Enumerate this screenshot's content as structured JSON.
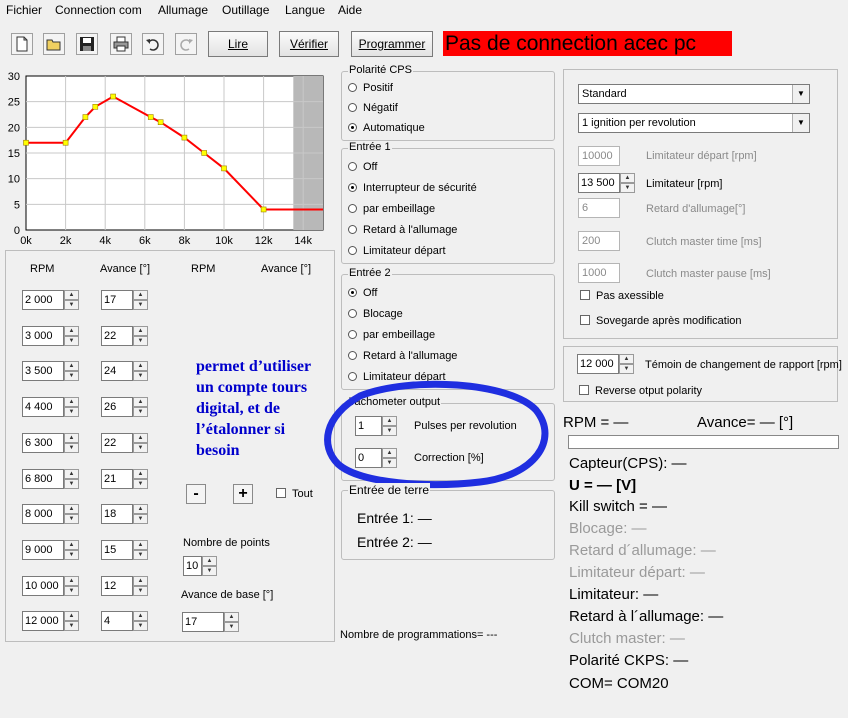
{
  "menu": [
    "Fichier",
    "Connection com",
    "Allumage",
    "Outillage",
    "Langue",
    "Aide"
  ],
  "toolbar": {
    "icons": [
      "new-file-icon",
      "open-folder-icon",
      "save-icon",
      "print-icon",
      "undo-icon",
      "redo-icon"
    ],
    "read_label": "Lire",
    "verify_label": "Vérifier",
    "program_label": "Programmer"
  },
  "status": {
    "text": "Pas de connection acec pc",
    "color": "#ff0000"
  },
  "chart_data": {
    "type": "line",
    "x": [
      0,
      2000,
      3000,
      3500,
      4400,
      6300,
      6800,
      8000,
      9000,
      10000,
      12000,
      15000
    ],
    "y": [
      17,
      17,
      22,
      24,
      26,
      22,
      21,
      18,
      15,
      12,
      4,
      4
    ],
    "markers": [
      true,
      true,
      true,
      true,
      true,
      true,
      true,
      true,
      true,
      true,
      true,
      false
    ],
    "xlim": [
      0,
      15000
    ],
    "ylim": [
      0,
      30
    ],
    "shaded_from": 13500,
    "x_tick_labels": [
      "0k",
      "2k",
      "4k",
      "6k",
      "8k",
      "10k",
      "12k",
      "14k"
    ],
    "y_tick_labels": [
      "0",
      "5",
      "10",
      "15",
      "20",
      "25",
      "30"
    ],
    "grid": true,
    "line_color": "#ff0000",
    "marker_color": "#ffff00"
  },
  "curve": {
    "header_rpm": "RPM",
    "header_advance": "Avance [°]",
    "header_rpm_2": "RPM",
    "header_advance_2": "Avance [°]",
    "rpm": [
      "2 000",
      "3 000",
      "3 500",
      "4 400",
      "6 300",
      "6 800",
      "8 000",
      "9 000",
      "10 000",
      "12 000"
    ],
    "advance": [
      "17",
      "22",
      "24",
      "26",
      "22",
      "21",
      "18",
      "15",
      "12",
      "4"
    ],
    "minus_label": "-",
    "plus_label": "+",
    "all_label": "Tout",
    "points_label": "Nombre de points",
    "points_value": "10",
    "base_advance_label": "Avance de base [°]",
    "base_advance_value": "17"
  },
  "annotation": {
    "lines": [
      "permet d’utiliser",
      "un compte tours",
      "digital, et de",
      "l’étalonner si",
      "besoin"
    ]
  },
  "polarity": {
    "title": "Polarité CPS",
    "options": [
      "Positif",
      "Négatif",
      "Automatique"
    ],
    "selected": 2
  },
  "input1": {
    "title": "Entrée 1",
    "options": [
      "Off",
      "Interrupteur de sécurité",
      "par embeillage",
      "Retard à l'allumage",
      "Limitateur départ"
    ],
    "selected": 1
  },
  "input2": {
    "title": "Entrée 2",
    "options": [
      "Off",
      "Blocage",
      "par embeillage",
      "Retard à l'allumage",
      "Limitateur départ"
    ],
    "selected": 0
  },
  "tachometer": {
    "title": "Tachometer output",
    "pulses_value": "1",
    "pulses_label": "Pulses per revolution",
    "correction_value": "0",
    "correction_label": "Correction [%]"
  },
  "ground": {
    "title": "Entrée de terre",
    "input1": "Entrée 1: —",
    "input2": "Entrée 2: —"
  },
  "programs_count": "Nombre de programmations= ---",
  "settings": {
    "mode": "Standard",
    "ignition": "1 ignition per revolution",
    "start_limiter_value": "10000",
    "start_limiter_label": "Limitateur départ [rpm]",
    "limiter_value": "13 500",
    "limiter_label": "Limitateur [rpm]",
    "delay_value": "6",
    "delay_label": "Retard d'allumage[°]",
    "clutch_time_value": "200",
    "clutch_time_label": "Clutch master time [ms]",
    "clutch_pause_value": "1000",
    "clutch_pause_label": "Clutch master pause [ms]",
    "not_accessible_label": "Pas axessible",
    "save_after_label": "Sovegarde après modification"
  },
  "shift": {
    "value": "12 000",
    "label": "Témoin de changement de rapport [rpm]",
    "reverse_label": "Reverse otput polarity"
  },
  "readout": {
    "rpm": "RPM = —",
    "advance": "Avance= — [°]",
    "sensor": "Capteur(CPS): —",
    "voltage": "U = — [V]",
    "kill_switch": "Kill switch = —",
    "blocking": "Blocage: —",
    "delay": "Retard d´allumage: —",
    "start_limiter": "Limitateur départ: —",
    "limiter": "Limitateur: —",
    "delay2": "Retard à l´allumage: —",
    "clutch": "Clutch master: —",
    "polarity": "Polarité CKPS: —",
    "com": "COM= COM20"
  }
}
